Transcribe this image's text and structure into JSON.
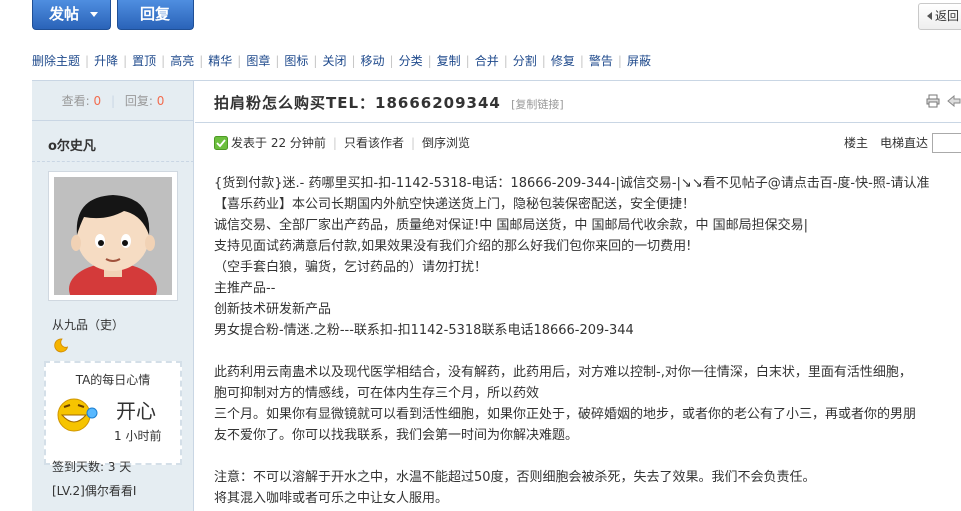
{
  "toolbar": {
    "post_label": "发帖",
    "reply_label": "回复",
    "back_label": "返回"
  },
  "moderation": [
    "删除主题",
    "升降",
    "置顶",
    "高亮",
    "精华",
    "图章",
    "图标",
    "关闭",
    "移动",
    "分类",
    "复制",
    "合并",
    "分割",
    "修复",
    "警告",
    "屏蔽"
  ],
  "stats": {
    "views_label": "查看:",
    "views": "0",
    "replies_label": "回复:",
    "replies": "0"
  },
  "author": {
    "name": "o尔史凡",
    "rank": "从九品（吏）",
    "mood_title": "TA的每日心情",
    "mood": "开心",
    "mood_time": "1 小时前",
    "sign_days": "签到天数: 3 天",
    "level": "[LV.2]偶尔看看I"
  },
  "thread": {
    "title": "拍肩粉怎么购买TEL：18666209344",
    "copy_link": "[复制链接]"
  },
  "post_info": {
    "posted": "发表于 22 分钟前",
    "author_only": "只看该作者",
    "reverse": "倒序浏览",
    "floor": "楼主",
    "jump": "电梯直达"
  },
  "content": [
    "{货到付款}迷.- 药哪里买扣-扣-1142-5318-电话：18666-209-344-|诚信交易-|↘↘看不见帖子@请点击百-度-快-照-请认准",
    "【喜乐药业】本公司长期国内外航空快递送货上门，隐秘包装保密配送，安全便捷！",
    "诚信交易、全部厂家出产药品，质量绝对保证!中 国邮局送货，中 国邮局代收余款，中 国邮局担保交易|",
    "支持见面试药满意后付款,如果效果没有我们介绍的那么好我们包你来回的一切费用!",
    "（空手套白狼，骗货，乞讨药品的）请勿打扰！",
    "主推产品--",
    "创新技术研发新产品",
    "男女提合粉-情迷.之粉---联系扣-扣1142-5318联系电话18666-209-344",
    "",
    "此药利用云南蛊术以及现代医学相结合，没有解药，此药用后，对方难以控制-,对你一往情深，白末状，里面有活性细胞，",
    "胞可抑制对方的情感线，可在体内生存三个月，所以药效",
    "三个月。如果你有显微镜就可以看到活性细胞，如果你正处于，破碎婚姻的地步，或者你的老公有了小三，再或者你的男朋",
    "友不爱你了。你可以找我联系，我们会第一时间为你解决难题。",
    "",
    "注意：不可以溶解于开水之中，水温不能超过50度，否则细胞会被杀死，失去了效果。我们不会负责任。",
    "将其混入咖啡或者可乐之中让女人服用。"
  ],
  "colors": {
    "accent_blue": "#2a63b8",
    "link": "#1f4a8c",
    "count_red": "#f26c4f",
    "sidebar_bg": "#e5edf2"
  }
}
